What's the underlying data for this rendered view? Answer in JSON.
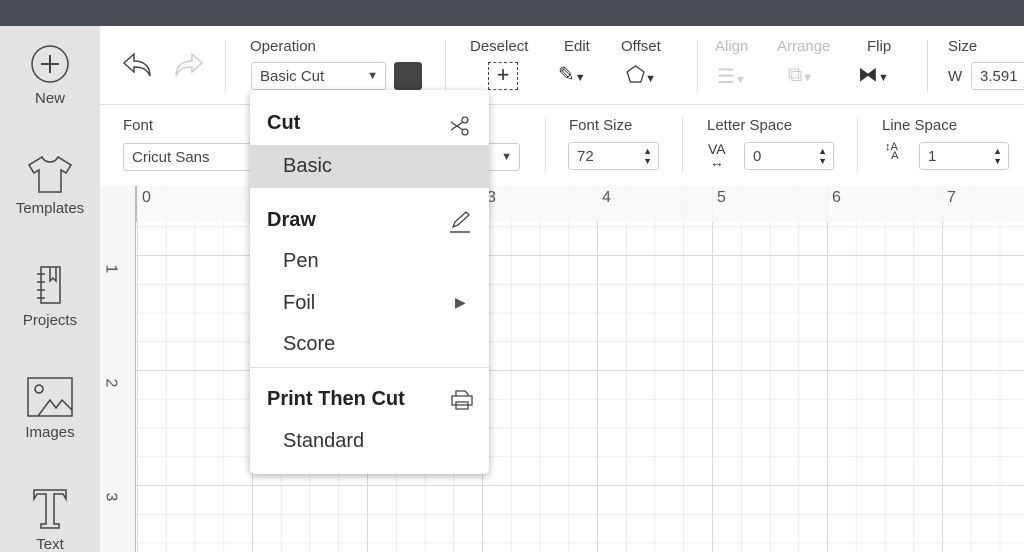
{
  "sidebar": {
    "items": [
      {
        "label": "New",
        "icon": "plus-circle-icon"
      },
      {
        "label": "Templates",
        "icon": "tshirt-icon"
      },
      {
        "label": "Projects",
        "icon": "notebook-icon"
      },
      {
        "label": "Images",
        "icon": "image-icon"
      },
      {
        "label": "Text",
        "icon": "text-icon"
      }
    ]
  },
  "toolbar": {
    "operation_label": "Operation",
    "operation_value": "Basic Cut",
    "operation_color": "#444444",
    "deselect": "Deselect",
    "edit": "Edit",
    "offset": "Offset",
    "align": "Align",
    "arrange": "Arrange",
    "flip": "Flip",
    "size": "Size",
    "w_label": "W",
    "w_value": "3.591"
  },
  "text_toolbar": {
    "font_label": "Font",
    "font_value": "Cricut Sans",
    "font_size_label": "Font Size",
    "font_size": "72",
    "letter_space_label": "Letter Space",
    "letter_space": "0",
    "line_space_label": "Line Space",
    "line_space": "1"
  },
  "ruler": {
    "h": [
      "0",
      "3",
      "4",
      "5",
      "6",
      "7"
    ],
    "v": [
      "1",
      "2",
      "3"
    ]
  },
  "menu": {
    "groups": [
      {
        "title": "Cut",
        "icon": "scissors-icon",
        "items": [
          "Basic"
        ]
      },
      {
        "title": "Draw",
        "icon": "pen-icon",
        "items": [
          "Pen",
          "Foil",
          "Score"
        ]
      },
      {
        "title": "Print Then Cut",
        "icon": "printer-icon",
        "items": [
          "Standard"
        ]
      }
    ],
    "selected": "Basic"
  }
}
